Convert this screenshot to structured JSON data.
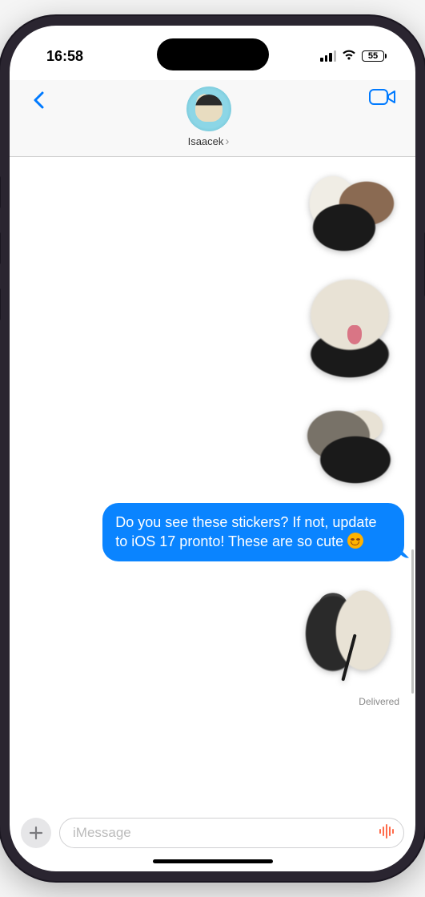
{
  "status": {
    "time": "16:58",
    "battery_pct": "55"
  },
  "header": {
    "contact_name": "Isaacek"
  },
  "messages": {
    "bubble_text": "Do you see these stickers? If not, update to iOS 17 pronto! These are so cute ",
    "sticker_alt_1": "two-dogs-playing-sticker",
    "sticker_alt_2": "white-dog-tongue-out-sticker",
    "sticker_alt_3": "dogs-wrestling-sticker",
    "sticker_alt_4": "two-dogs-standing-sticker",
    "delivered_label": "Delivered"
  },
  "input": {
    "placeholder": "iMessage"
  },
  "colors": {
    "accent": "#007aff",
    "bubble": "#0a84ff"
  }
}
